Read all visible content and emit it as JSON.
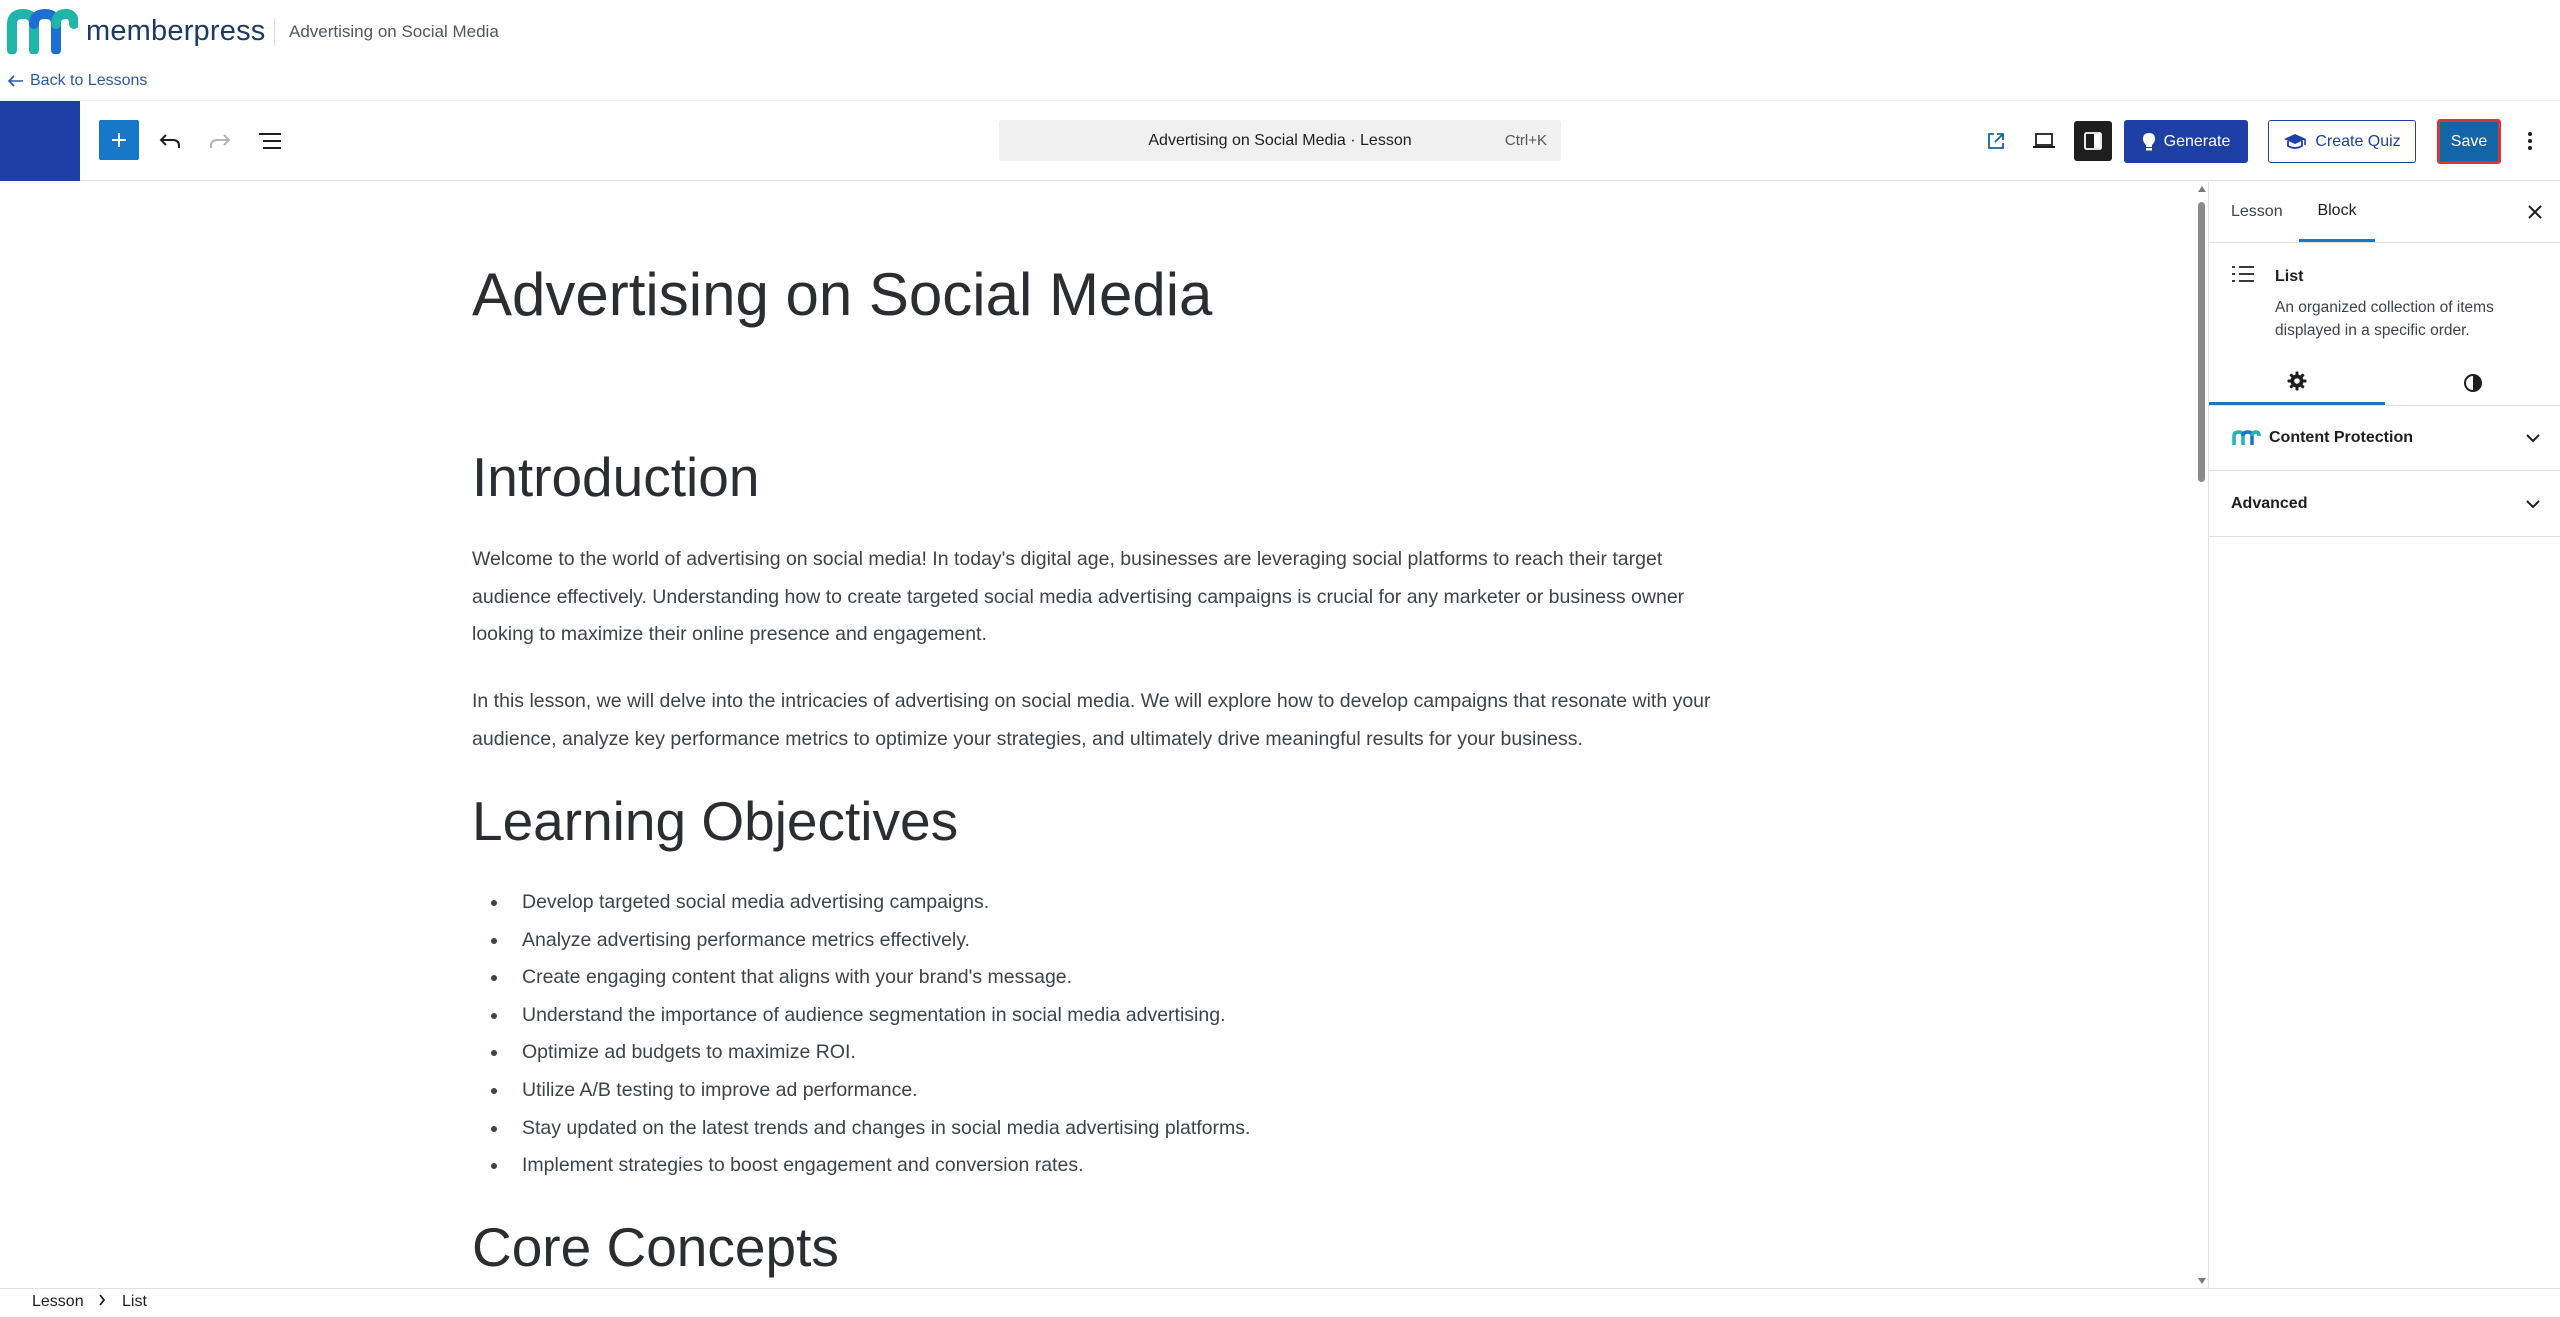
{
  "brand": {
    "logo_text": "memberpress",
    "page_title": "Advertising on Social Media",
    "back_link": "Back to Lessons"
  },
  "toolbar": {
    "command_title": "Advertising on Social Media · Lesson",
    "command_shortcut": "Ctrl+K",
    "generate_label": "Generate",
    "create_quiz_label": "Create Quiz",
    "save_label": "Save"
  },
  "post": {
    "title": "Advertising on Social Media",
    "intro_heading": "Introduction",
    "intro_p1": "Welcome to the world of advertising on social media! In today's digital age, businesses are leveraging social platforms to reach their target audience effectively. Understanding how to create targeted social media advertising campaigns is crucial for any marketer or business owner looking to maximize their online presence and engagement.",
    "intro_p2": "In this lesson, we will delve into the intricacies of advertising on social media. We will explore how to develop campaigns that resonate with your audience, analyze key performance metrics to optimize your strategies, and ultimately drive meaningful results for your business.",
    "objectives_heading": "Learning Objectives",
    "objectives": [
      "Develop targeted social media advertising campaigns.",
      "Analyze advertising performance metrics effectively.",
      "Create engaging content that aligns with your brand's message.",
      "Understand the importance of audience segmentation in social media advertising.",
      "Optimize ad budgets to maximize ROI.",
      "Utilize A/B testing to improve ad performance.",
      "Stay updated on the latest trends and changes in social media advertising platforms.",
      "Implement strategies to boost engagement and conversion rates."
    ],
    "core_heading": "Core Concepts"
  },
  "sidebar": {
    "tab_lesson": "Lesson",
    "tab_block": "Block",
    "block_name": "List",
    "block_description": "An organized collection of items displayed in a specific order.",
    "panel_content_protection": "Content Protection",
    "panel_advanced": "Advanced"
  },
  "footer": {
    "crumb_root": "Lesson",
    "crumb_current": "List"
  },
  "colors": {
    "accent_blue": "#1d3fa6",
    "save_blue": "#1464a8",
    "save_outline": "#d63638",
    "inserter_blue": "#1878c7",
    "logo_teal": "#1fb5a8"
  }
}
